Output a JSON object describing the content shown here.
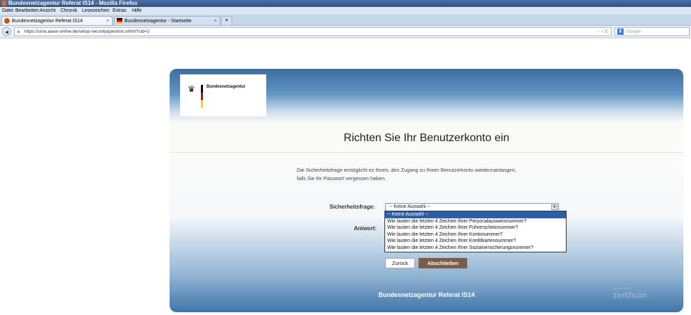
{
  "window": {
    "title": "Bundesnetzagentur Referat IS14 - Mozilla Firefox"
  },
  "menu": [
    "Datei",
    "Bearbeiten",
    "Ansicht",
    "Chronik",
    "Lesezeichen",
    "Extras",
    "Hilfe"
  ],
  "tabs": [
    {
      "label": "Bundesnetzagentur Referat IS14",
      "close": "×"
    },
    {
      "label": "Bundesnetzagentur - Startseite",
      "close": "×"
    }
  ],
  "newtab": "+",
  "nav": {
    "back": "◄",
    "url": "https://sma.aaue-online.de/setup-securityquestion.xhtml?cid=2",
    "star": "☆",
    "reload": "▿ C",
    "search_placeholder": "Google"
  },
  "page": {
    "logo_text": "Bundesnetzagentur",
    "heading": "Richten Sie Ihr Benutzerkonto ein",
    "intro": "Die Sicherheitsfrage ermöglicht es Ihnen, den Zugang zu Ihrem Benutzerkonto wiederzuerlangen, falls Sie Ihr Passwort vergessen haben.",
    "security_label": "Sicherheitsfrage:",
    "answer_label": "Antwort:",
    "select_value": "-- Keine Auswahl --",
    "options": [
      "-- Keine Auswahl --",
      "Wie lauten die letzten 4 Zeichen Ihrer Personalausweisnummer?",
      "Wie lauten die letzten 4 Zeichen Ihrer Führerscheinnummer?",
      "Wie lauten die letzten 4 Zeichen Ihrer Kontonummer?",
      "Wie lauten die letzten 4 Zeichen Ihrer Kreditkartennummer?",
      "Wie lauten die letzten 4 Zeichen Ihrer Sozialversicherungsnummer?"
    ],
    "back_button": "Zurück",
    "finish_button": "Abschließen",
    "footer": "Bundesnetzagentur Referat IS14",
    "powered_by": "powered by",
    "vendor": "zertificon"
  }
}
